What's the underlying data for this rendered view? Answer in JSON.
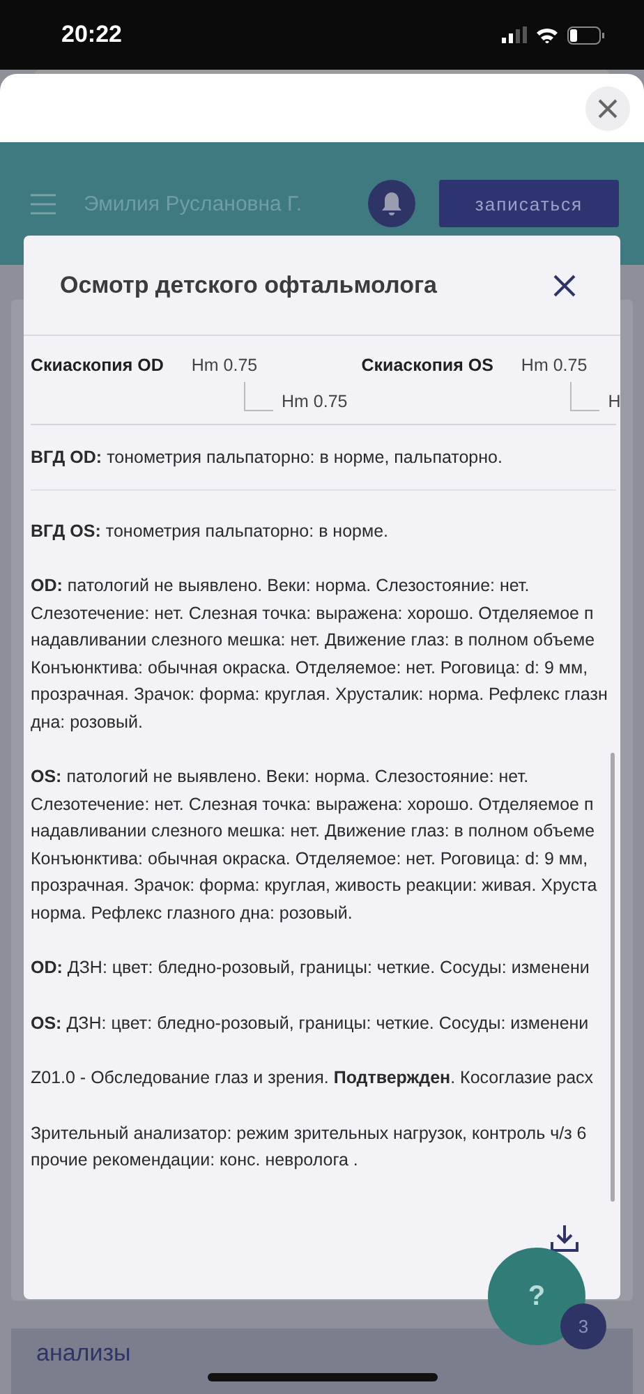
{
  "status_bar": {
    "time": "20:22"
  },
  "header": {
    "user_name": "Эмилия Руслановна Г.",
    "action_button": "записаться"
  },
  "modal": {
    "title": "Осмотр детского офтальмолога",
    "skiascopy": [
      {
        "label": "Скиаскопия OD",
        "value": "Hm 0.75",
        "sub_value": "Hm 0.75"
      },
      {
        "label": "Скиаскопия OS",
        "value": "Hm 0.75",
        "sub_value": "H"
      }
    ],
    "blocks": [
      {
        "divider_after": true,
        "lines": [
          "**ВГД OD:** тонометрия пальпаторно: в норме, пальпаторно."
        ]
      },
      {
        "divider_after": false,
        "lines": [
          "**ВГД OS:** тонометрия пальпаторно: в норме."
        ]
      },
      {
        "divider_after": false,
        "lines": [
          "**OD:** патологий не выявлено. Веки: норма. Слезостояние: нет.",
          "Слезотечение: нет. Слезная точка: выражена: хорошо. Отделяемое п",
          "надавливании слезного мешка: нет. Движение глаз: в полном объеме",
          "Конъюнктива: обычная окраска. Отделяемое: нет. Роговица: d: 9 мм,",
          "прозрачная. Зрачок: форма: круглая. Хрусталик: норма. Рефлекс глазн",
          "дна: розовый."
        ]
      },
      {
        "divider_after": false,
        "lines": [
          "**OS:** патологий не выявлено. Веки: норма. Слезостояние: нет.",
          "Слезотечение: нет. Слезная точка: выражена: хорошо. Отделяемое п",
          "надавливании слезного мешка: нет. Движение глаз: в полном объеме",
          "Конъюнктива: обычная окраска. Отделяемое: нет. Роговица: d: 9 мм,",
          "прозрачная. Зрачок: форма: круглая, живость реакции: живая. Хруста",
          "норма. Рефлекс глазного дна: розовый."
        ]
      },
      {
        "divider_after": false,
        "lines": [
          "**OD:** ДЗН: цвет: бледно-розовый, границы: четкие. Сосуды: изменени"
        ]
      },
      {
        "divider_after": false,
        "lines": [
          "**OS:** ДЗН: цвет: бледно-розовый, границы: четкие. Сосуды: изменени"
        ]
      },
      {
        "divider_after": false,
        "lines": [
          "Z01.0 - Обследование глаз и зрения. **Подтвержден**. Косоглазие расх"
        ]
      },
      {
        "divider_after": false,
        "lines": [
          "Зрительный анализатор: режим зрительных нагрузок, контроль ч/з 6",
          "прочие рекомендации: конс. невролога ."
        ]
      }
    ]
  },
  "help_button": {
    "label": "?",
    "badge": "3"
  },
  "bottom_section": {
    "title": "анализы"
  }
}
